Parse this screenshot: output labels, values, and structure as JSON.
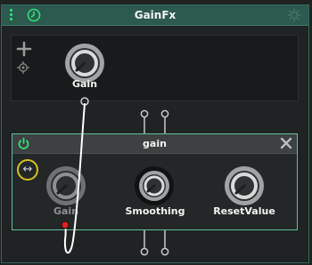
{
  "window": {
    "title": "GainFx"
  },
  "rack": {
    "knob": {
      "label": "Gain"
    }
  },
  "module": {
    "title": "gain",
    "knobs": [
      {
        "label": "Gain",
        "active": false
      },
      {
        "label": "Smoothing",
        "active": true
      },
      {
        "label": "ResetValue",
        "active": true
      }
    ]
  },
  "colors": {
    "accent": "#2fe07a",
    "title_bar": "#2c5a4f",
    "module_border": "#5fbf9a",
    "highlight_ring": "#d7c21c",
    "modulation_dot": "#e02020"
  },
  "icons": [
    "menu-icon",
    "clock-icon",
    "settings-icon",
    "plus-icon",
    "target-icon",
    "power-icon",
    "close-icon",
    "swap-icon"
  ]
}
